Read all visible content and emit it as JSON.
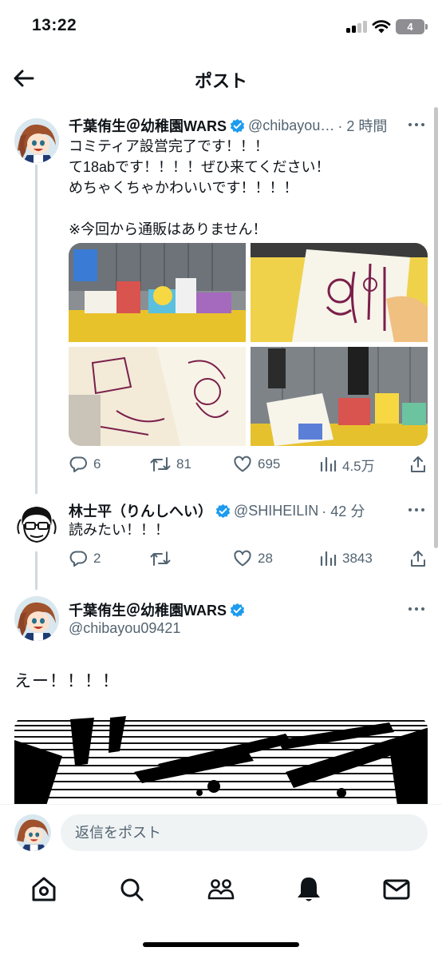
{
  "status": {
    "time": "13:22",
    "battery": "4"
  },
  "header": {
    "title": "ポスト"
  },
  "tweets": [
    {
      "name": "千葉侑生＠幼稚園WARS",
      "handle": "@chibayou…",
      "time": "· 2 時間",
      "text": "コミティア設営完了です！！！\nて18abです！！！！ぜひ来てください！\nめちゃくちゃかわいいです！！！！\n\n※今回から通販はありません！",
      "replies": "6",
      "retweets": "81",
      "likes": "695",
      "views": "4.5万"
    },
    {
      "name": "林士平（りんしへい）",
      "handle": "@SHIHEILIN",
      "time": "· 42 分",
      "text": "読みたい！！！",
      "replies": "2",
      "retweets": "",
      "likes": "28",
      "views": "3843"
    }
  ],
  "main_tweet": {
    "name": "千葉侑生＠幼稚園WARS",
    "handle": "@chibayou09421",
    "text": "えー！！！！"
  },
  "reply": {
    "placeholder": "返信をポスト"
  },
  "icons": {
    "back": "arrow-left-icon",
    "verified": "verified-badge-icon",
    "reply": "comment-icon",
    "retweet": "retweet-icon",
    "like": "heart-icon",
    "views": "bar-chart-icon",
    "share": "share-icon",
    "tabs": [
      "home-icon",
      "search-icon",
      "communities-icon",
      "bell-icon",
      "mail-icon"
    ]
  },
  "colors": {
    "accent": "#1d9bf0",
    "muted": "#536471",
    "text": "#0f1419"
  }
}
